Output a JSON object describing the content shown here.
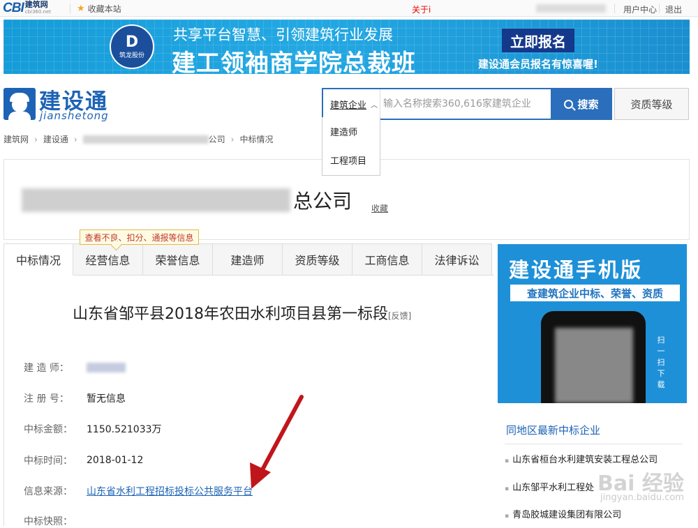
{
  "topbar": {
    "logo_cbi": "CBI",
    "logo_name": "建筑网",
    "logo_url": "cbi360.net",
    "favorite": "收藏本站",
    "about": "关于i",
    "user_center": "用户中心",
    "logout": "退出"
  },
  "banner": {
    "subtitle": "共享平台智慧、引领建筑行业发展",
    "title": "建工领袖商学院总裁班",
    "button": "立即报名",
    "note": "建设通会员报名有惊喜喔!",
    "logo_mark": "D",
    "logo_name": "筑龙股份"
  },
  "brand": {
    "name": "建设通",
    "pinyin": "jianshetong"
  },
  "search": {
    "category": "建筑企业",
    "placeholder": "输入名称搜索360,616家建筑企业",
    "button": "搜索",
    "dropdown": [
      "建造师",
      "工程项目"
    ],
    "qualification": "资质等级"
  },
  "breadcrumb": {
    "items": [
      "建筑网",
      "建设通"
    ],
    "blurred_suffix": "公司",
    "current": "中标情况"
  },
  "company": {
    "name_visible": "总公司",
    "collect": "收藏",
    "tooltip": "查看不良、扣分、通报等信息"
  },
  "tabs": [
    "中标情况",
    "经营信息",
    "荣誉信息",
    "建造师",
    "资质等级",
    "工商信息",
    "法律诉讼"
  ],
  "detail": {
    "title": "山东省邹平县2018年农田水利项目县第一标段",
    "feedback": "[反馈]",
    "rows": {
      "builder_label": "建 造 师：",
      "reg_label": "注 册 号：",
      "reg_value": "暂无信息",
      "amount_label": "中标金额：",
      "amount_value": "1150.521033万",
      "time_label": "中标时间：",
      "time_value": "2018-01-12",
      "source_label": "信息来源：",
      "source_value": "山东省水利工程招标投标公共服务平台",
      "snapshot_label": "中标快照："
    }
  },
  "sidebar": {
    "ad_title": "建设通手机版",
    "ad_subtitle": "查建筑企业中标、荣誉、资质",
    "ad_scan": "扫一扫下载",
    "list_title": "同地区最新中标企业",
    "list_items": [
      "山东省桓台水利建筑安装工程总公司",
      "山东邹平水利工程处",
      "青岛胶城建设集团有限公司"
    ]
  },
  "watermark": {
    "text": "Bai 经验",
    "url": "jingyan.baidu.com"
  },
  "colors": {
    "primary": "#2a6ebc",
    "banner": "#1e90d8",
    "link": "#1d63b5",
    "arrow": "#c0161b",
    "tooltip_text": "#c0392b"
  }
}
